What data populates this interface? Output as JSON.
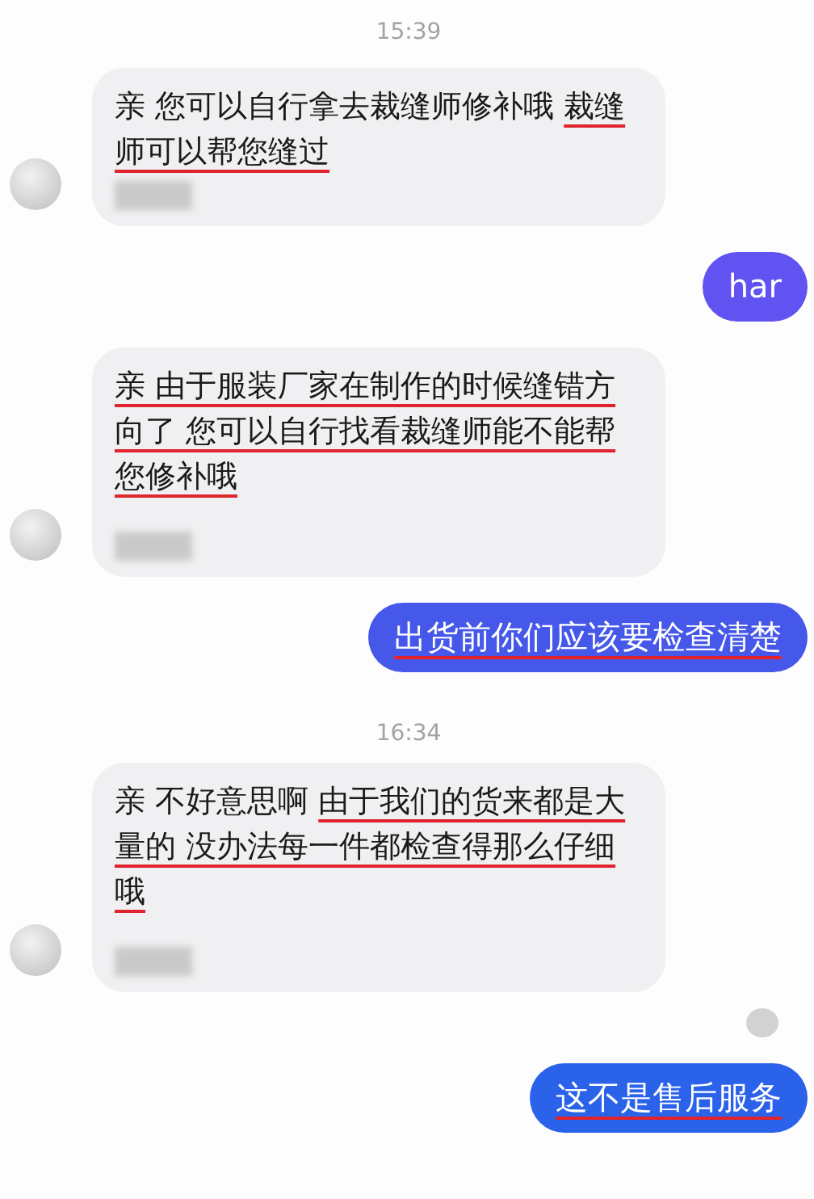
{
  "messages": [
    {
      "kind": "time",
      "text": "15:39"
    },
    {
      "kind": "incoming",
      "segments": [
        {
          "text": "亲 您可以自行拿去裁缝师修补哦 ",
          "underlined": false
        },
        {
          "text": "裁缝师可以帮您缝过",
          "underlined": true
        }
      ]
    },
    {
      "kind": "outgoing",
      "color": "#6152f2",
      "segments": [
        {
          "text": "har",
          "underlined": false
        }
      ]
    },
    {
      "kind": "incoming",
      "segments": [
        {
          "text": "亲 由于服装厂家在制作的时候缝错方向了 您可以自行找看裁缝师能不能帮您修补哦",
          "underlined": true
        }
      ]
    },
    {
      "kind": "outgoing",
      "color": "#4658ea",
      "segments": [
        {
          "text": "出货前你们应该要检查清楚",
          "underlined": true
        }
      ]
    },
    {
      "kind": "time",
      "text": "16:34"
    },
    {
      "kind": "incoming",
      "segments": [
        {
          "text": "亲 不好意思啊 ",
          "underlined": false
        },
        {
          "text": "由于我们的货来都是大量的 没办法每一件都检查得那么仔细哦",
          "underlined": true
        }
      ]
    },
    {
      "kind": "receipt"
    },
    {
      "kind": "outgoing",
      "color": "#2b62ea",
      "segments": [
        {
          "text": "这不是售后服务",
          "underlined": true
        }
      ]
    }
  ]
}
